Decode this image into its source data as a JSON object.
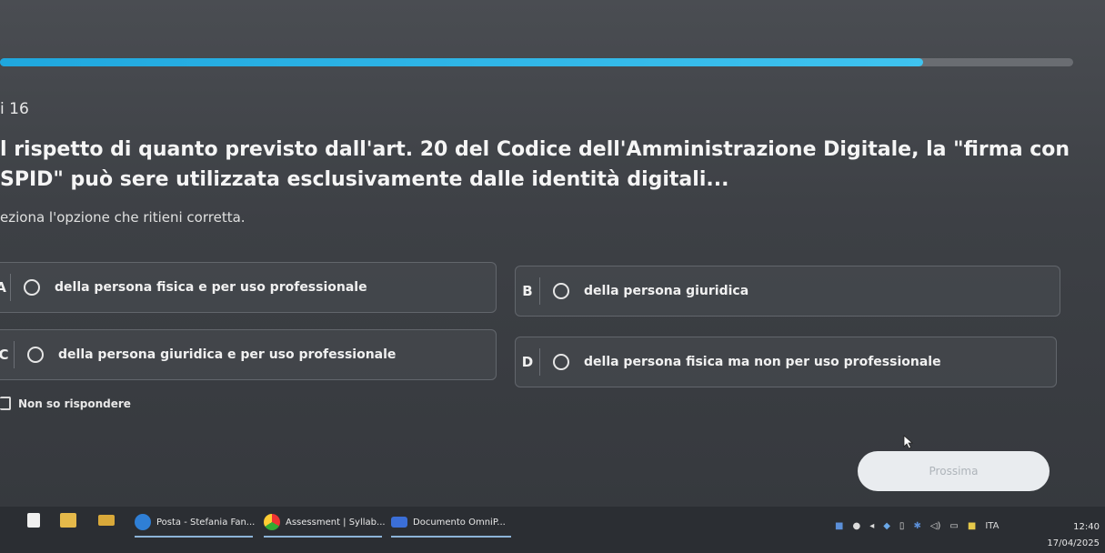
{
  "progress": {
    "fraction": 0.86
  },
  "question": {
    "number": "i 16",
    "text": "l rispetto di quanto previsto dall'art. 20 del Codice dell'Amministrazione Digitale, la \"firma con SPID\" può sere utilizzata esclusivamente dalle identità digitali...",
    "instruction": "eziona l'opzione che ritieni corretta."
  },
  "options": [
    {
      "letter": "A",
      "text": "della persona fisica e per uso professionale"
    },
    {
      "letter": "B",
      "text": "della persona giuridica"
    },
    {
      "letter": "C",
      "text": "della persona giuridica e per uso professionale"
    },
    {
      "letter": "D",
      "text": "della persona fisica ma non per uso professionale"
    }
  ],
  "skip_label": "Non so rispondere",
  "next_label": "Prossima",
  "taskbar": {
    "apps": [
      {
        "label": "Posta - Stefania Fan...",
        "icon": "mail-icon"
      },
      {
        "label": "Assessment | Syllab...",
        "icon": "chrome-icon"
      },
      {
        "label": "Documento OmniP...",
        "icon": "document-icon"
      }
    ],
    "language": "ITA",
    "time": "12:40",
    "date": "17/04/2025"
  },
  "colors": {
    "accent": "#1fa7de",
    "button_bg": "#e9ecef"
  }
}
